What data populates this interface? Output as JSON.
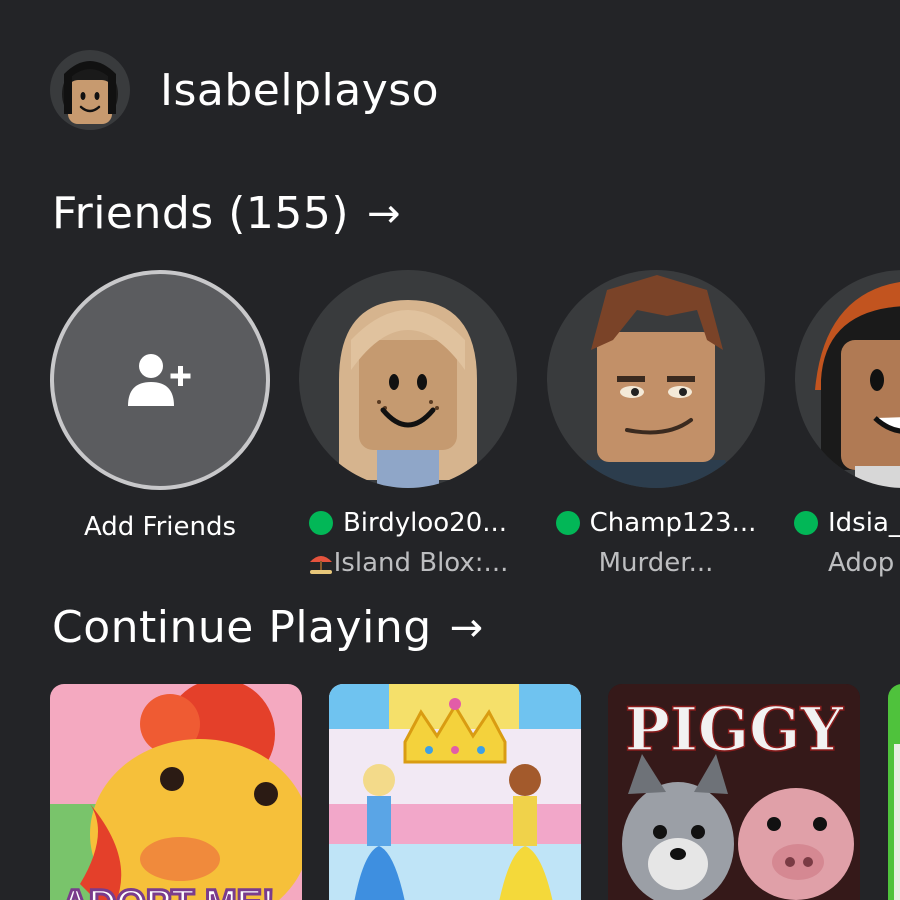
{
  "user": {
    "display_name": "Isabelplayso",
    "avatar_icon": "user-avatar"
  },
  "friends_section": {
    "title": "Friends (155)",
    "arrow": "→"
  },
  "add_friends": {
    "label": "Add Friends",
    "icon": "add-friend-icon"
  },
  "friends": [
    {
      "name": "Birdyloo20...",
      "status": "Island Blox:...",
      "status_icon": "beach-umbrella-icon",
      "online": true
    },
    {
      "name": "Champ123...",
      "status": "Murder...",
      "online": true
    },
    {
      "name": "Idsia_",
      "status": "Adop",
      "online": true
    }
  ],
  "continue_section": {
    "title": "Continue Playing",
    "arrow": "→"
  },
  "games": [
    {
      "title": "ADOPT ME!"
    },
    {
      "title": ""
    },
    {
      "title": "PIGGY"
    },
    {
      "title": ""
    }
  ],
  "colors": {
    "background": "#232427",
    "online_green": "#02b757",
    "secondary_text": "#bdbec0"
  }
}
